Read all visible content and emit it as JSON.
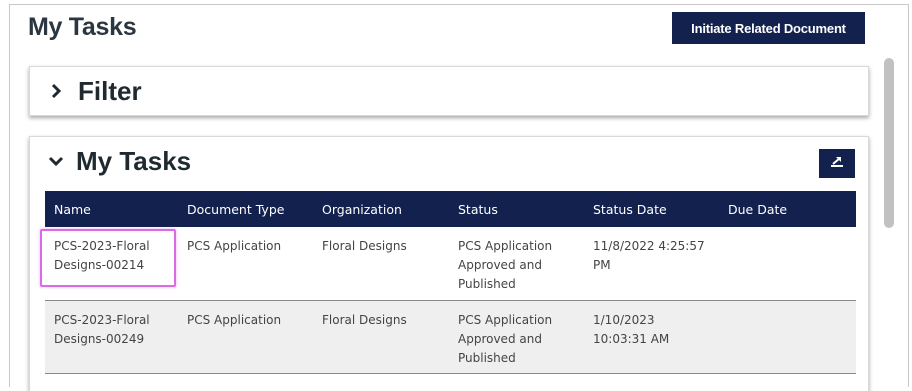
{
  "page": {
    "title": "My Tasks",
    "initiate_button_label": "Initiate Related Document"
  },
  "filter_panel": {
    "title": "Filter",
    "icon": "chevron-right-icon"
  },
  "tasks_panel": {
    "title": "My Tasks",
    "icon": "chevron-down-icon",
    "export_icon": "export-icon",
    "columns": [
      "Name",
      "Document Type",
      "Organization",
      "Status",
      "Status Date",
      "Due Date"
    ],
    "rows": [
      {
        "name": "PCS-2023-Floral Designs-00214",
        "document_type": "PCS Application",
        "organization": "Floral Designs",
        "status": "PCS Application Approved and Published",
        "status_date": "11/8/2022 4:25:57 PM",
        "due_date": ""
      },
      {
        "name": "PCS-2023-Floral Designs-00249",
        "document_type": "PCS Application",
        "organization": "Floral Designs",
        "status": "PCS Application Approved and Published",
        "status_date": "1/10/2023 10:03:31 AM",
        "due_date": ""
      }
    ]
  },
  "colors": {
    "navy": "#13214f",
    "link": "#1a3ec7",
    "highlight": "#d96be6"
  }
}
